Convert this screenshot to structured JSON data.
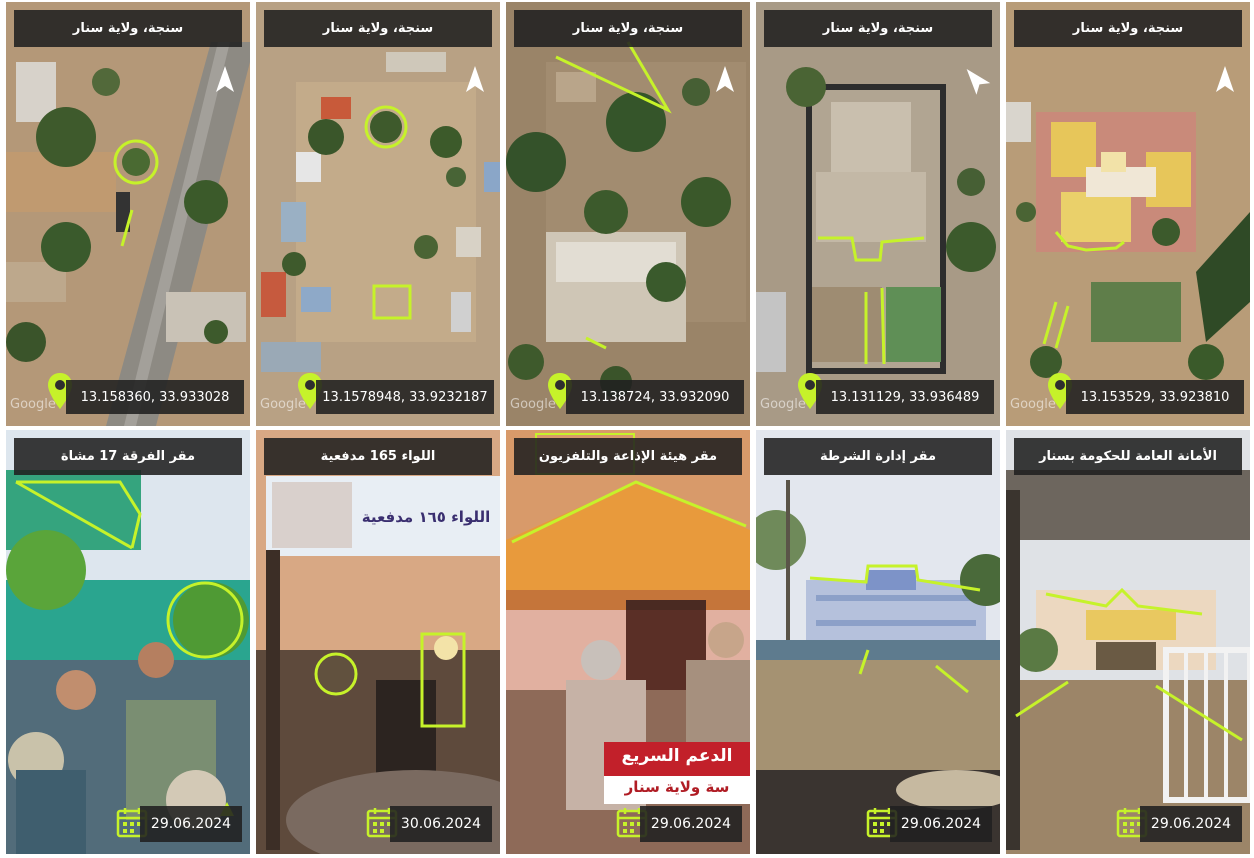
{
  "accent_color": "#c6f22a",
  "satellite_panels": [
    {
      "title": "سنجة، ولاية سنار",
      "coords": "13.158360, 33.933028",
      "watermark": "Google"
    },
    {
      "title": "سنجة، ولاية سنار",
      "coords": "13.1578948, 33.9232187",
      "watermark": "Google"
    },
    {
      "title": "سنجة، ولاية سنار",
      "coords": "13.138724, 33.932090",
      "watermark": "Google"
    },
    {
      "title": "سنجة، ولاية سنار",
      "coords": "13.131129, 33.936489",
      "watermark": "Google"
    },
    {
      "title": "سنجة، ولاية سنار",
      "coords": "13.153529, 33.923810",
      "watermark": "Google"
    }
  ],
  "photo_panels": [
    {
      "title": "مقر الفرقة 17 مشاة",
      "date": "29.06.2024"
    },
    {
      "title": "اللواء 165 مدفعية",
      "date": "30.06.2024",
      "sign_text": "اللواء ١٦٥ مدفعية"
    },
    {
      "title": "مقر هيئة الإذاعة والتلفزيون",
      "date": "29.06.2024",
      "banner_line1": "الدعم السريع",
      "banner_line2": "سة ولاية سنار"
    },
    {
      "title": "مقر إدارة الشرطة",
      "date": "29.06.2024"
    },
    {
      "title": "الأمانة العامة للحكومة بسنار",
      "date": "29.06.2024"
    }
  ],
  "icons": {
    "location": "map-pin-icon",
    "date": "calendar-icon",
    "north": "north-arrow-icon",
    "warning": "warning-icon"
  }
}
